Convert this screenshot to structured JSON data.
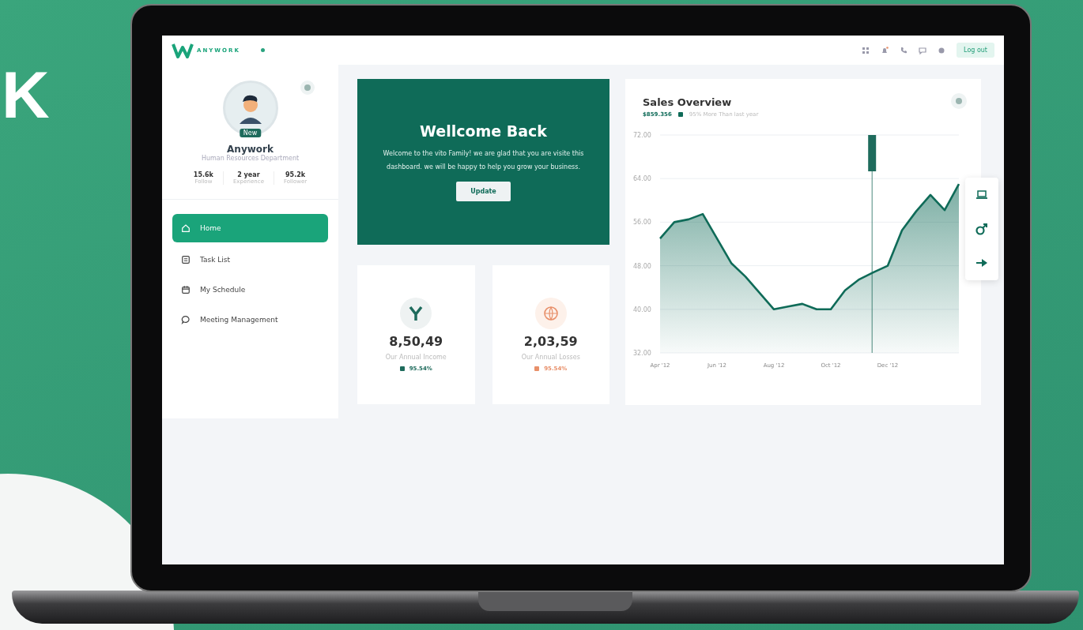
{
  "hero": {
    "letter": "K"
  },
  "brand": {
    "name": "ANYWORK"
  },
  "topbar": {
    "logout": "Log out"
  },
  "profile": {
    "name": "Anywork",
    "department": "Human Resources Department",
    "badge": "New",
    "stats": [
      {
        "value": "15.6k",
        "label": "Follow"
      },
      {
        "value": "2 year",
        "label": "Experience"
      },
      {
        "value": "95.2k",
        "label": "Follower"
      }
    ]
  },
  "nav": [
    {
      "kind": "home",
      "label": "Home",
      "selected": true
    },
    {
      "kind": "list",
      "label": "Task List",
      "selected": false
    },
    {
      "kind": "calendar",
      "label": "My Schedule",
      "selected": false
    },
    {
      "kind": "chat",
      "label": "Meeting Management",
      "selected": false
    }
  ],
  "welcome": {
    "title": "Wellcome Back",
    "text": "Welcome to the vito Family! we are glad that you are visite this dashboard. we will be happy to help you grow your business.",
    "button": "Update"
  },
  "stats": [
    {
      "kind": "income",
      "value": "8,50,49",
      "label": "Our Annual Income",
      "change": "95.54%",
      "color": "#1e6b5c"
    },
    {
      "kind": "loss",
      "value": "2,03,59",
      "label": "Our Annual Losses",
      "change": "95.54%",
      "color": "#e8906a"
    }
  ],
  "sales": {
    "title": "Sales Overview",
    "amount": "$859.356",
    "note": "95% More Than last year",
    "chart_data": {
      "type": "area",
      "grid": true,
      "ylim": [
        32,
        72
      ],
      "yticks": [
        {
          "value": 72,
          "label": "72.00"
        },
        {
          "value": 64,
          "label": "64.00"
        },
        {
          "value": 56,
          "label": "56.00"
        },
        {
          "value": 48,
          "label": "48.00"
        },
        {
          "value": 40,
          "label": "40.00"
        },
        {
          "value": 32,
          "label": "32.00"
        }
      ],
      "categories": [
        "Apr '12",
        null,
        null,
        null,
        "Jun '12",
        null,
        null,
        null,
        "Aug '12",
        null,
        null,
        null,
        "Oct '12",
        null,
        null,
        null,
        "Dec '12",
        null,
        null,
        null,
        null,
        null
      ],
      "series": [
        {
          "color": "#0f6b58",
          "values": [
            53,
            56,
            56.5,
            57.5,
            53,
            48.5,
            46,
            43,
            40,
            40.5,
            41,
            40,
            40,
            43.5,
            45.5,
            46.8,
            48,
            54.5,
            58,
            61,
            58.2,
            63
          ]
        }
      ]
    }
  }
}
